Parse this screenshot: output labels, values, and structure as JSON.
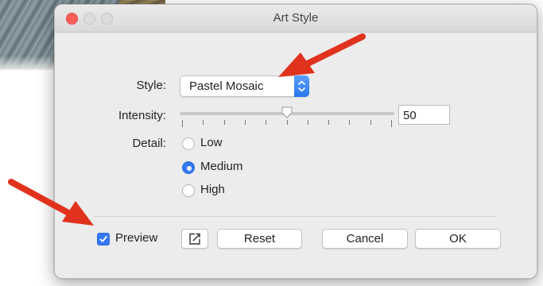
{
  "dialog": {
    "title": "Art Style",
    "style_label": "Style:",
    "style_value": "Pastel Mosaic",
    "intensity_label": "Intensity:",
    "intensity_value": "50",
    "intensity_fraction": 0.5,
    "detail_label": "Detail:",
    "detail_options": [
      "Low",
      "Medium",
      "High"
    ],
    "detail_selected": "Medium",
    "preview_label": "Preview",
    "preview_checked": true,
    "reset_label": "Reset",
    "cancel_label": "Cancel",
    "ok_label": "OK"
  },
  "colors": {
    "accent": "#3478f6",
    "close_button": "#fd5f57",
    "annotation_arrow": "#e0321c"
  },
  "icons": {
    "open_editor": "external-edit-icon",
    "popup_stepper": "up-down-chevron-icon"
  }
}
